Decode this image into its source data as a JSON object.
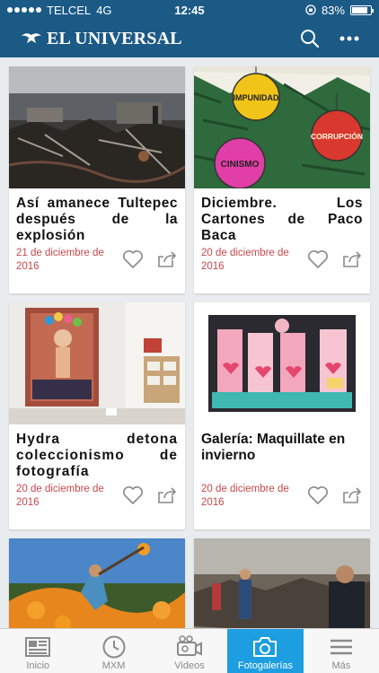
{
  "status_bar": {
    "carrier": "TELCEL",
    "network": "4G",
    "time": "12:45",
    "battery_percent": "83%",
    "battery_level": 0.83
  },
  "header": {
    "brand": "EL UNIVERSAL",
    "search_icon": "search-icon",
    "menu_icon": "more-icon"
  },
  "cards": [
    {
      "title": "Así amanece Tultepec después de la explosión",
      "date": "21 de diciembre de 2016"
    },
    {
      "title": "Diciembre. Los Cartones de Paco Baca",
      "date": "20 de diciembre de 2016"
    },
    {
      "title": "Hydra detona coleccionismo de fotografía",
      "date": "20 de diciembre de 2016"
    },
    {
      "title": "Galería: Maquillate en invierno",
      "date": "20 de diciembre de 2016"
    }
  ],
  "cartoon_words": [
    "IMPUNIDAD",
    "CORRUPCIÓN",
    "CINISMO"
  ],
  "tabs": [
    {
      "label": "Inicio",
      "icon": "newspaper-icon",
      "active": false
    },
    {
      "label": "MXM",
      "icon": "clock-icon",
      "active": false
    },
    {
      "label": "Videos",
      "icon": "video-camera-icon",
      "active": false
    },
    {
      "label": "Fotogalerías",
      "icon": "camera-icon",
      "active": true
    },
    {
      "label": "Más",
      "icon": "hamburger-icon",
      "active": false
    }
  ],
  "colors": {
    "header_bg": "#1c5a86",
    "date_red": "#c9474b",
    "tab_active": "#1c9ee0"
  }
}
